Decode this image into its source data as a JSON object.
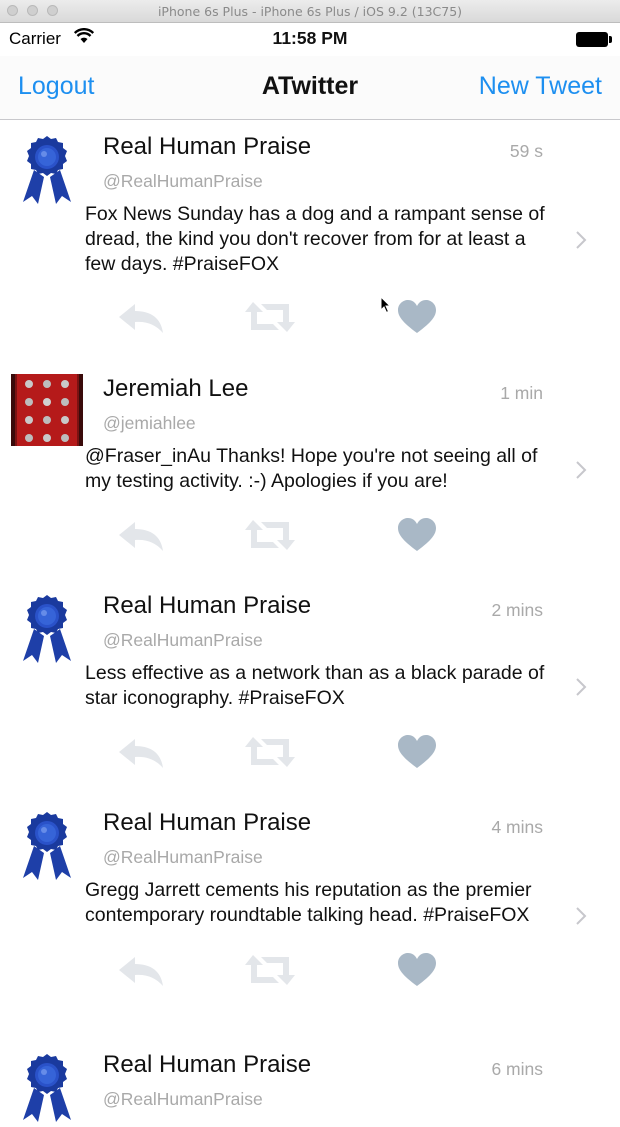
{
  "simulator": {
    "title": "iPhone 6s Plus - iPhone 6s Plus / iOS 9.2 (13C75)"
  },
  "status_bar": {
    "carrier": "Carrier",
    "time": "11:58 PM"
  },
  "nav": {
    "left_label": "Logout",
    "title": "ATwitter",
    "right_label": "New Tweet"
  },
  "tweets": [
    {
      "name": "Real Human Praise",
      "handle": "@RealHumanPraise",
      "time": "59 s",
      "text": "Fox News Sunday has a dog and a rampant sense of dread, the kind you don't recover from for at least a few days. #PraiseFOX",
      "avatar": "blue-ribbon"
    },
    {
      "name": "Jeremiah Lee",
      "handle": "@jemiahlee",
      "time": "1 min",
      "text": "@Fraser_inAu Thanks! Hope you're not seeing all of my testing activity. :-) Apologies if you are!",
      "avatar": "photo"
    },
    {
      "name": "Real Human Praise",
      "handle": "@RealHumanPraise",
      "time": "2 mins",
      "text": "Less effective as a network than as a black parade of star iconography. #PraiseFOX",
      "avatar": "blue-ribbon"
    },
    {
      "name": "Real Human Praise",
      "handle": "@RealHumanPraise",
      "time": "4 mins",
      "text": "Gregg Jarrett cements his reputation as the premier contemporary roundtable talking head. #PraiseFOX",
      "avatar": "blue-ribbon"
    },
    {
      "name": "Real Human Praise",
      "handle": "@RealHumanPraise",
      "time": "6 mins",
      "text": "",
      "avatar": "blue-ribbon"
    }
  ],
  "colors": {
    "accent": "#1d8ff0",
    "muted": "#a9a9a9",
    "action_icon": "#e3e6ea",
    "heart": "#a9b8c6"
  }
}
